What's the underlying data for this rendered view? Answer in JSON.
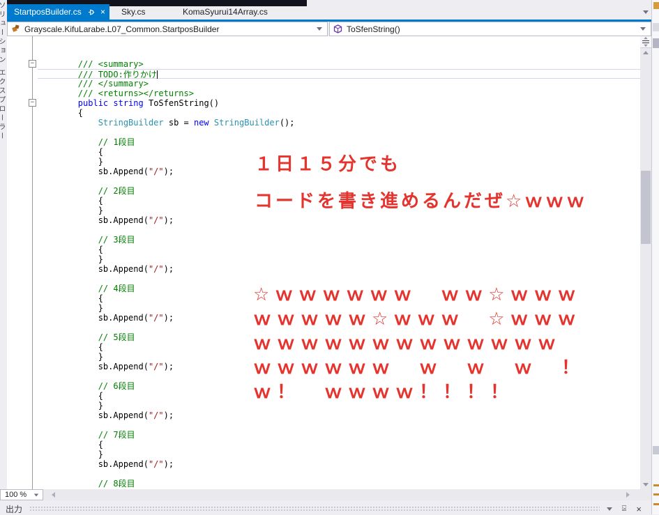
{
  "colors": {
    "accent_blue": "#007acc",
    "comment_green": "#008000",
    "keyword_blue": "#0000ff",
    "type_teal": "#2b91af",
    "string_red": "#a31515",
    "annotation_red": "#e5332e"
  },
  "left_strip": {
    "vertical_label": "ソリューション エクスプローラー"
  },
  "tabs": [
    {
      "label": "StartposBuilder.cs",
      "active": true
    },
    {
      "label": "Sky.cs",
      "active": false
    },
    {
      "label": "KomaSyurui14Array.cs",
      "active": false
    }
  ],
  "navbar": {
    "type_dropdown": "Grayscale.KifuLarabe.L07_Common.StartposBuilder",
    "member_dropdown": "ToSfenString()"
  },
  "editor": {
    "lines": [
      {
        "seg": []
      },
      {
        "seg": []
      },
      {
        "seg": [
          {
            "t": "        /// <summary>",
            "c": "com"
          }
        ],
        "fold": true
      },
      {
        "seg": [
          {
            "t": "        /// TODO:作りかけ",
            "c": "com"
          }
        ],
        "current": true,
        "caret": true
      },
      {
        "seg": [
          {
            "t": "        /// </summary>",
            "c": "com"
          }
        ]
      },
      {
        "seg": [
          {
            "t": "        /// <returns></returns>",
            "c": "com"
          }
        ]
      },
      {
        "seg": [
          {
            "t": "        ",
            "c": "pln"
          },
          {
            "t": "public",
            "c": "kw"
          },
          {
            "t": " ",
            "c": "pln"
          },
          {
            "t": "string",
            "c": "kw"
          },
          {
            "t": " ToSfenString()",
            "c": "pln"
          }
        ],
        "fold": true
      },
      {
        "seg": [
          {
            "t": "        {",
            "c": "pln"
          }
        ]
      },
      {
        "seg": [
          {
            "t": "            ",
            "c": "pln"
          },
          {
            "t": "StringBuilder",
            "c": "typ"
          },
          {
            "t": " sb = ",
            "c": "pln"
          },
          {
            "t": "new",
            "c": "kw"
          },
          {
            "t": " ",
            "c": "pln"
          },
          {
            "t": "StringBuilder",
            "c": "typ"
          },
          {
            "t": "();",
            "c": "pln"
          }
        ]
      },
      {
        "seg": []
      },
      {
        "seg": [
          {
            "t": "            // 1段目",
            "c": "com"
          }
        ]
      },
      {
        "seg": [
          {
            "t": "            {",
            "c": "pln"
          }
        ]
      },
      {
        "seg": [
          {
            "t": "            }",
            "c": "pln"
          }
        ]
      },
      {
        "seg": [
          {
            "t": "            sb.Append(",
            "c": "pln"
          },
          {
            "t": "\"/\"",
            "c": "str"
          },
          {
            "t": ");",
            "c": "pln"
          }
        ]
      },
      {
        "seg": []
      },
      {
        "seg": [
          {
            "t": "            // 2段目",
            "c": "com"
          }
        ]
      },
      {
        "seg": [
          {
            "t": "            {",
            "c": "pln"
          }
        ]
      },
      {
        "seg": [
          {
            "t": "            }",
            "c": "pln"
          }
        ]
      },
      {
        "seg": [
          {
            "t": "            sb.Append(",
            "c": "pln"
          },
          {
            "t": "\"/\"",
            "c": "str"
          },
          {
            "t": ");",
            "c": "pln"
          }
        ]
      },
      {
        "seg": []
      },
      {
        "seg": [
          {
            "t": "            // 3段目",
            "c": "com"
          }
        ]
      },
      {
        "seg": [
          {
            "t": "            {",
            "c": "pln"
          }
        ]
      },
      {
        "seg": [
          {
            "t": "            }",
            "c": "pln"
          }
        ]
      },
      {
        "seg": [
          {
            "t": "            sb.Append(",
            "c": "pln"
          },
          {
            "t": "\"/\"",
            "c": "str"
          },
          {
            "t": ");",
            "c": "pln"
          }
        ]
      },
      {
        "seg": []
      },
      {
        "seg": [
          {
            "t": "            // 4段目",
            "c": "com"
          }
        ]
      },
      {
        "seg": [
          {
            "t": "            {",
            "c": "pln"
          }
        ]
      },
      {
        "seg": [
          {
            "t": "            }",
            "c": "pln"
          }
        ]
      },
      {
        "seg": [
          {
            "t": "            sb.Append(",
            "c": "pln"
          },
          {
            "t": "\"/\"",
            "c": "str"
          },
          {
            "t": ");",
            "c": "pln"
          }
        ]
      },
      {
        "seg": []
      },
      {
        "seg": [
          {
            "t": "            // 5段目",
            "c": "com"
          }
        ]
      },
      {
        "seg": [
          {
            "t": "            {",
            "c": "pln"
          }
        ]
      },
      {
        "seg": [
          {
            "t": "            }",
            "c": "pln"
          }
        ]
      },
      {
        "seg": [
          {
            "t": "            sb.Append(",
            "c": "pln"
          },
          {
            "t": "\"/\"",
            "c": "str"
          },
          {
            "t": ");",
            "c": "pln"
          }
        ]
      },
      {
        "seg": []
      },
      {
        "seg": [
          {
            "t": "            // 6段目",
            "c": "com"
          }
        ]
      },
      {
        "seg": [
          {
            "t": "            {",
            "c": "pln"
          }
        ]
      },
      {
        "seg": [
          {
            "t": "            }",
            "c": "pln"
          }
        ]
      },
      {
        "seg": [
          {
            "t": "            sb.Append(",
            "c": "pln"
          },
          {
            "t": "\"/\"",
            "c": "str"
          },
          {
            "t": ");",
            "c": "pln"
          }
        ]
      },
      {
        "seg": []
      },
      {
        "seg": [
          {
            "t": "            // 7段目",
            "c": "com"
          }
        ]
      },
      {
        "seg": [
          {
            "t": "            {",
            "c": "pln"
          }
        ]
      },
      {
        "seg": [
          {
            "t": "            }",
            "c": "pln"
          }
        ]
      },
      {
        "seg": [
          {
            "t": "            sb.Append(",
            "c": "pln"
          },
          {
            "t": "\"/\"",
            "c": "str"
          },
          {
            "t": ");",
            "c": "pln"
          }
        ]
      },
      {
        "seg": []
      },
      {
        "seg": [
          {
            "t": "            // 8段目",
            "c": "com"
          }
        ]
      },
      {
        "seg": [
          {
            "t": "            {",
            "c": "pln"
          }
        ]
      }
    ]
  },
  "overlay": {
    "intro_lines": [
      "１日１５分でも",
      "コードを書き進めるんだぜ☆ｗｗｗ"
    ],
    "w_lines": [
      "☆ｗｗｗｗｗｗ　ｗｗ☆ｗｗｗ",
      "ｗｗｗｗｗ☆ｗｗｗ　☆ｗｗｗ",
      "ｗｗｗｗｗｗｗｗｗｗｗｗｗ",
      "ｗｗｗｗｗｗ　ｗ　ｗ　ｗ　！",
      "ｗ！　ｗｗｗｗ！！！！"
    ]
  },
  "bottom": {
    "zoom": "100 %"
  },
  "output_panel": {
    "title": "出力"
  }
}
